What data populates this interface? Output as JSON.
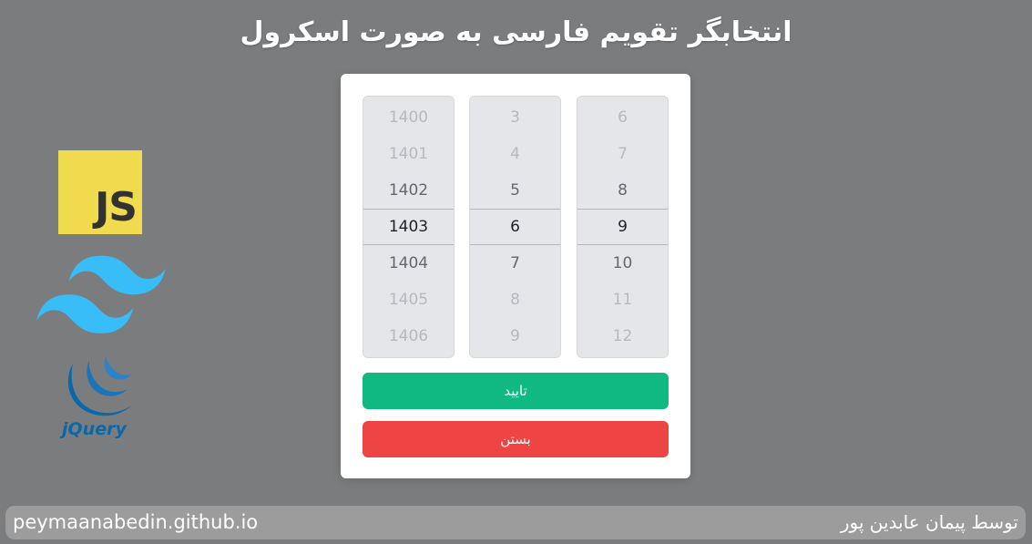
{
  "header": {
    "title": "انتخابگر تقویم فارسی به صورت اسکرول"
  },
  "logos": [
    {
      "name": "javascript-logo",
      "text": "JS",
      "color": "#f0db4f"
    },
    {
      "name": "tailwind-logo",
      "color": "#38bdf8"
    },
    {
      "name": "jquery-logo",
      "text": "jQuery",
      "color": "#0868ac"
    }
  ],
  "picker": {
    "years": [
      "1400",
      "1401",
      "1402",
      "1403",
      "1404",
      "1405",
      "1406"
    ],
    "months": [
      "3",
      "4",
      "5",
      "6",
      "7",
      "8",
      "9"
    ],
    "days": [
      "6",
      "7",
      "8",
      "9",
      "10",
      "11",
      "12"
    ],
    "selected": {
      "year": "1403",
      "month": "6",
      "day": "9"
    },
    "confirm_label": "تایید",
    "close_label": "بستن",
    "colors": {
      "confirm": "#10b981",
      "close": "#ef4444"
    }
  },
  "footer": {
    "url": "peymaanabedin.github.io",
    "author": "توسط پیمان عابدین پور"
  }
}
